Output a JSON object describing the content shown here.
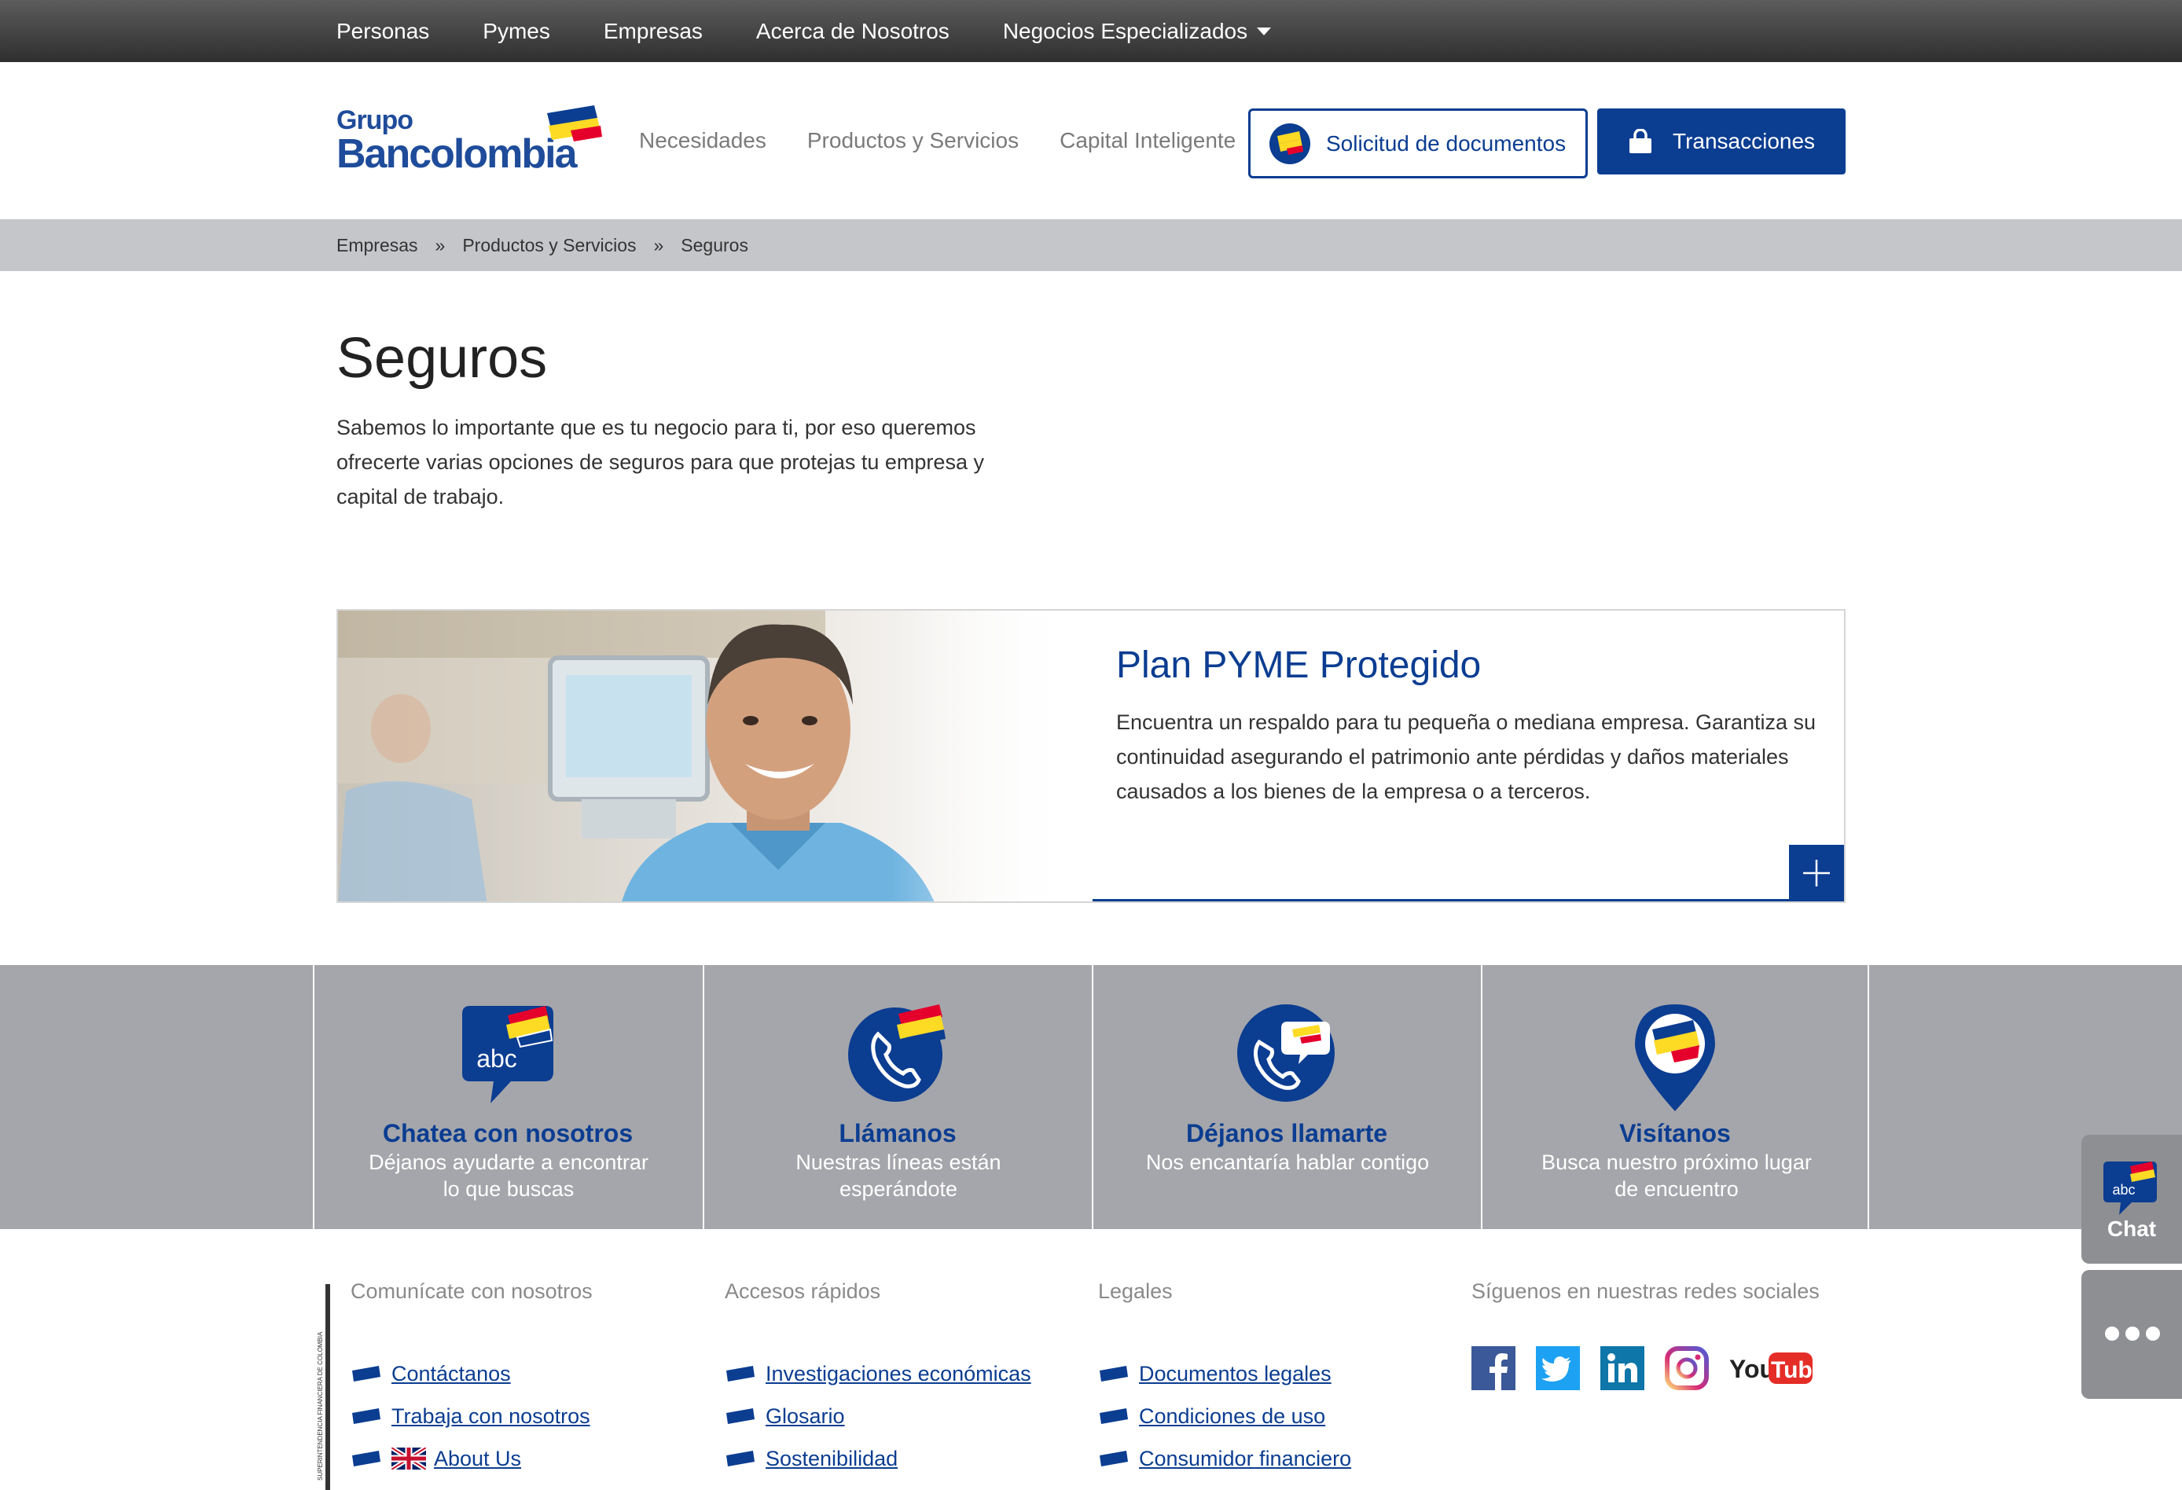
{
  "topnav": {
    "items": [
      "Personas",
      "Pymes",
      "Empresas",
      "Acerca de Nosotros",
      "Negocios Especializados"
    ]
  },
  "header": {
    "logo_line1": "Grupo",
    "logo_line2": "Bancolombia",
    "nav": [
      "Necesidades",
      "Productos y Servicios",
      "Capital Inteligente"
    ],
    "docs_button": "Solicitud de documentos",
    "transactions_button": "Transacciones"
  },
  "breadcrumb": {
    "items": [
      "Empresas",
      "Productos y Servicios",
      "Seguros"
    ],
    "separator": "»"
  },
  "main": {
    "title": "Seguros",
    "intro": "Sabemos lo importante que es tu negocio para ti, por eso queremos ofrecerte varias opciones de seguros para que protejas tu empresa y capital de trabajo.",
    "card": {
      "title": "Plan PYME Protegido",
      "text": "Encuentra un respaldo para tu pequeña o mediana empresa. Garantiza su continuidad asegurando el patrimonio ante pérdidas y daños materiales causados a los bienes de la empresa o a terceros."
    }
  },
  "contact": {
    "items": [
      {
        "title": "Chatea con nosotros",
        "desc": "Déjanos ayudarte a encontrar lo que buscas",
        "icon": "chat-abc-icon"
      },
      {
        "title": "Llámanos",
        "desc": "Nuestras líneas están esperándote",
        "icon": "phone-icon"
      },
      {
        "title": "Déjanos llamarte",
        "desc": "Nos encantaría hablar contigo",
        "icon": "callback-icon"
      },
      {
        "title": "Visítanos",
        "desc": "Busca nuestro próximo lugar de encuentro",
        "icon": "location-pin-icon"
      }
    ]
  },
  "footer": {
    "col1": {
      "heading": "Comunícate con nosotros",
      "links": [
        "Contáctanos",
        "Trabaja con nosotros",
        "About Us"
      ]
    },
    "col2": {
      "heading": "Accesos rápidos",
      "links": [
        "Investigaciones económicas",
        "Glosario",
        "Sostenibilidad"
      ]
    },
    "col3": {
      "heading": "Legales",
      "links": [
        "Documentos legales",
        "Condiciones de uso",
        "Consumidor financiero"
      ]
    },
    "col4": {
      "heading": "Síguenos en nuestras redes sociales",
      "networks": [
        "Facebook",
        "Twitter",
        "LinkedIn",
        "Instagram",
        "YouTube"
      ]
    },
    "youtube_you": "You",
    "youtube_tube": "Tube",
    "sfc_text": "SUPERINTENDENCIA FINANCIERA DE COLOMBIA"
  },
  "side": {
    "chat_icon_text": "abc",
    "chat_label": "Chat",
    "more_icon": "more-dots-icon"
  },
  "colors": {
    "brand_blue": "#0b3d91",
    "yellow": "#fdda24",
    "red": "#e4002b",
    "band_gray": "#a5a6ab"
  }
}
